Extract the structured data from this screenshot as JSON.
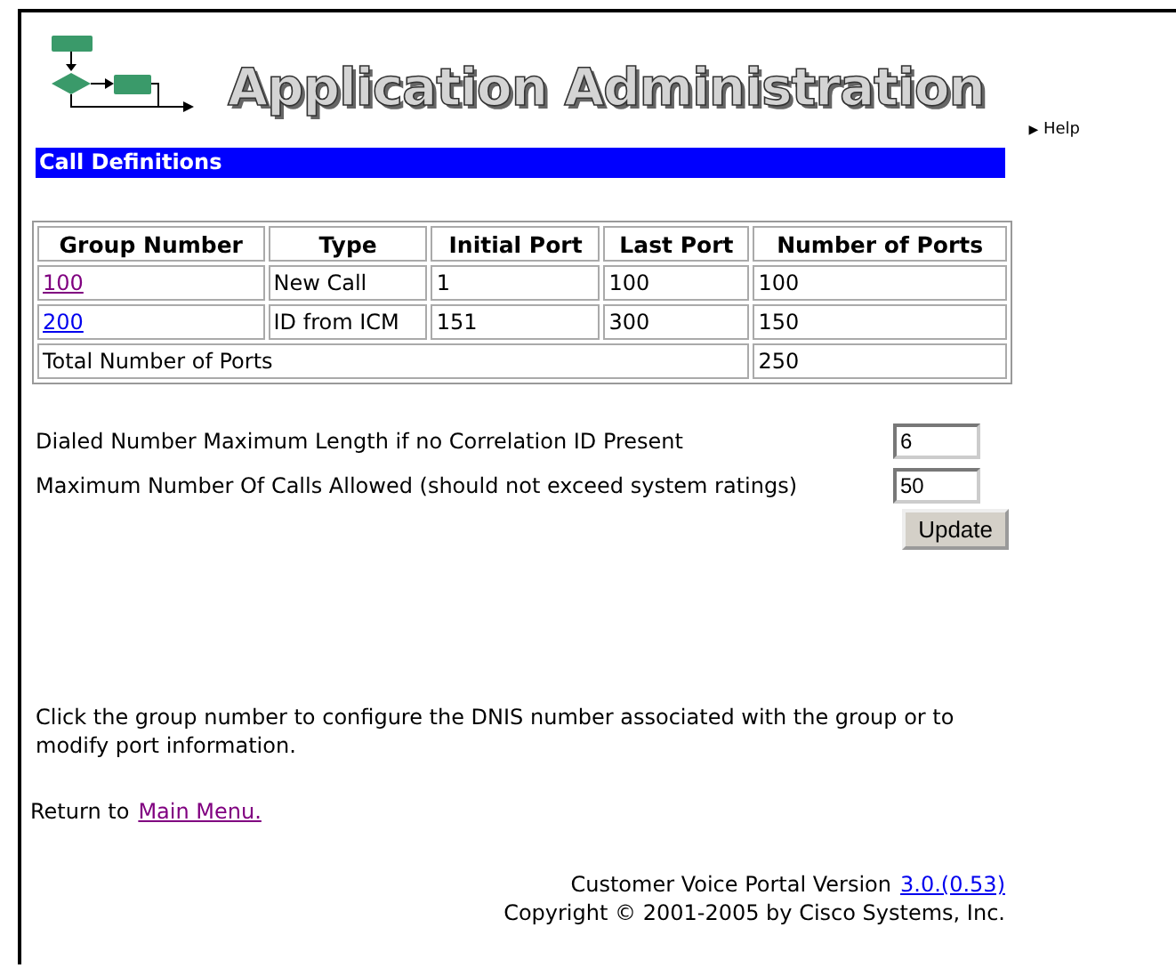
{
  "header": {
    "title": "Application Administration",
    "help_link": {
      "arrow": "▶",
      "label": "Help"
    }
  },
  "section_bar": {
    "title": "Call Definitions"
  },
  "table": {
    "columns": [
      "Group Number",
      "Type",
      "Initial Port",
      "Last Port",
      "Number of Ports"
    ],
    "rows": [
      {
        "group": {
          "label": "100",
          "visited": true
        },
        "type": "New Call",
        "initial_port": "1",
        "last_port": "100",
        "number_of_ports": "100"
      },
      {
        "group": {
          "label": "200",
          "visited": false
        },
        "type": "ID from ICM",
        "initial_port": "151",
        "last_port": "300",
        "number_of_ports": "150"
      }
    ],
    "total": {
      "label": "Total Number of Ports",
      "value": "250"
    }
  },
  "settings": [
    {
      "label": "Dialed Number Maximum Length if no Correlation ID Present",
      "value": "6"
    },
    {
      "label": "Maximum Number Of Calls Allowed (should not exceed system ratings)",
      "value": "50"
    }
  ],
  "update_button": "Update",
  "note": "Click the group number to configure the DNIS number associated with the group or to modify port information.",
  "return_line": {
    "text": "Return to",
    "link": {
      "label": "Main Menu.",
      "visited": true
    }
  },
  "footer": {
    "version_text": "Customer Voice Portal Version",
    "version_link": {
      "label": "3.0.(0.53)",
      "visited": false
    },
    "copyright": "Copyright © 2001-2005 by Cisco Systems, Inc."
  }
}
